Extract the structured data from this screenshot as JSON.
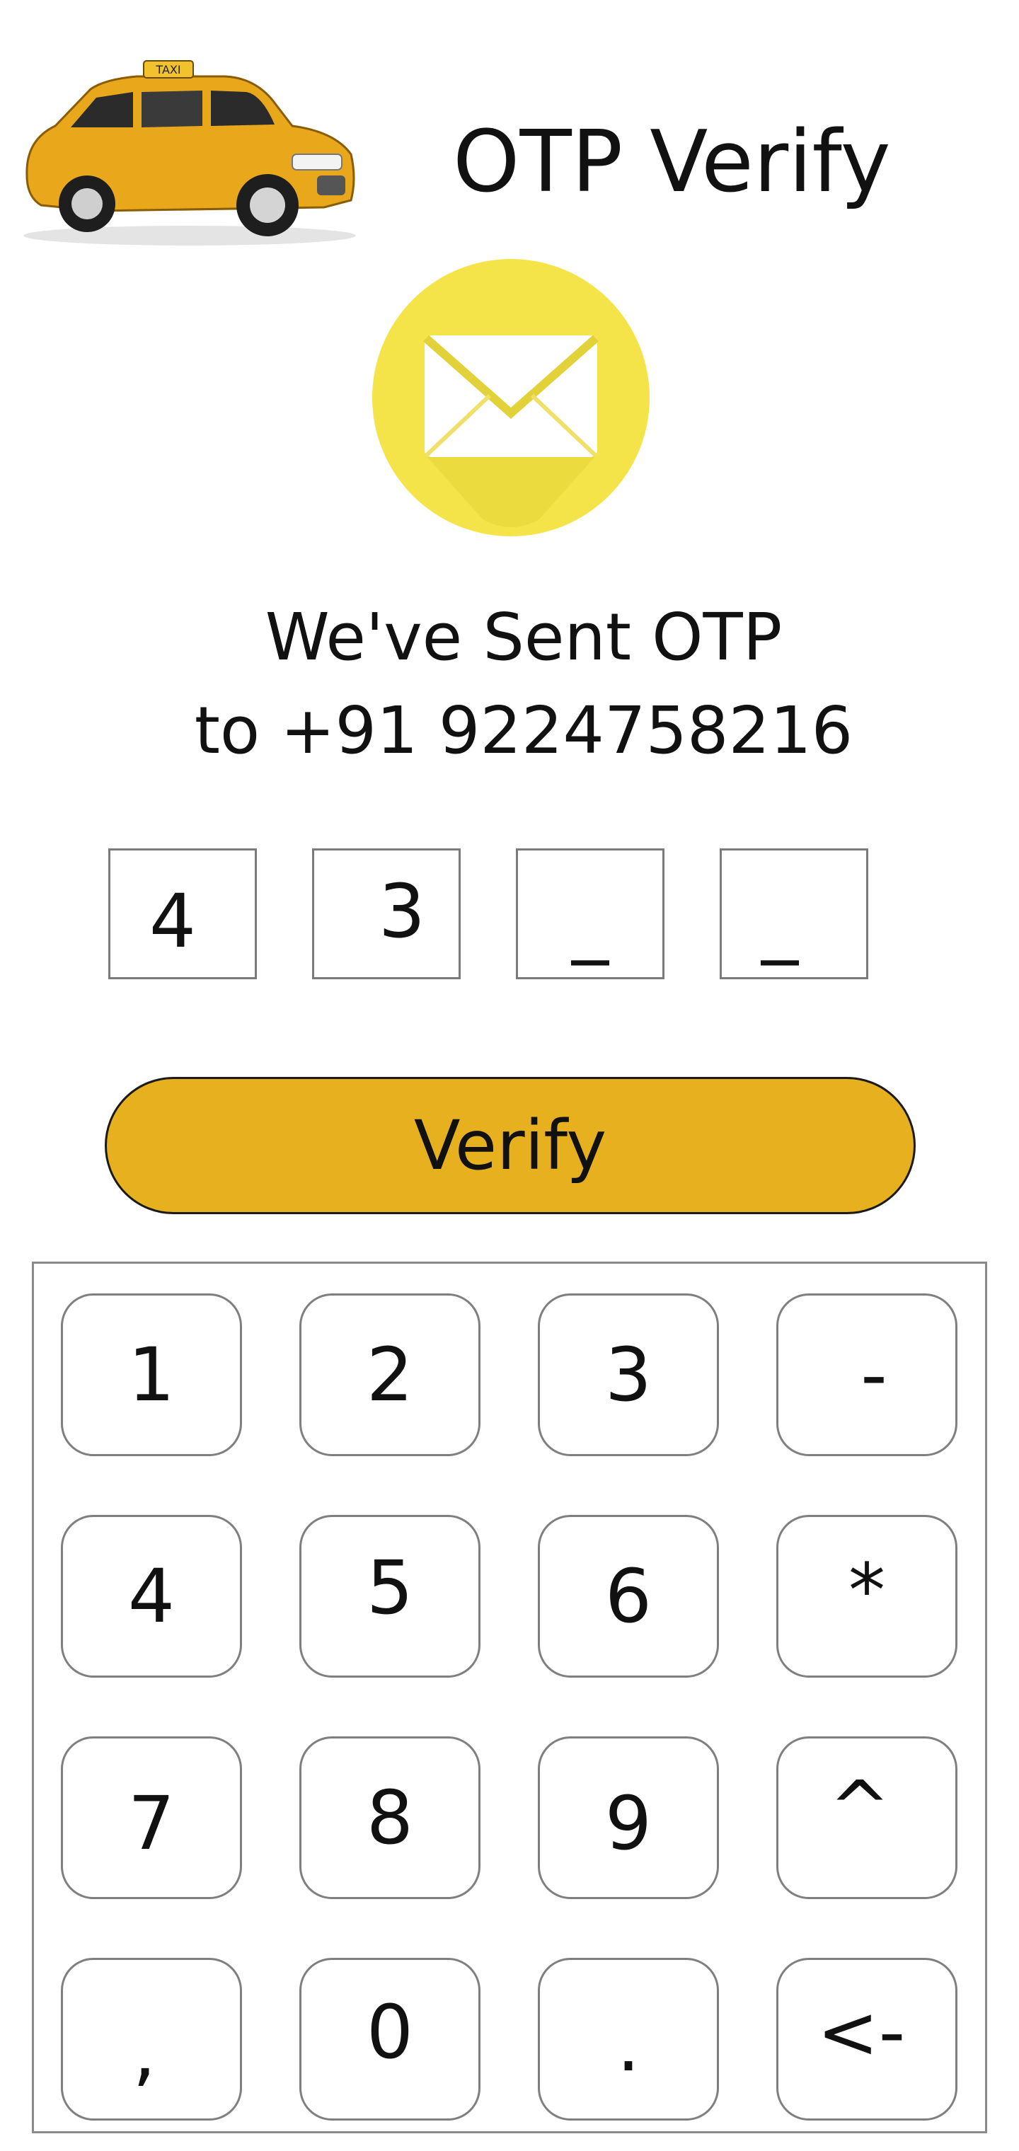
{
  "header": {
    "title": "OTP Verify",
    "taxi_sign": "TAXI"
  },
  "icons": {
    "taxi": "taxi-car-icon",
    "mail": "mail-envelope-icon"
  },
  "message": {
    "line1": "We've Sent OTP",
    "line2": "to +91 9224758216"
  },
  "otp": {
    "digits": [
      "4",
      "3",
      "_",
      "_"
    ]
  },
  "verify": {
    "label": "Verify"
  },
  "keypad": {
    "keys": [
      "1",
      "2",
      "3",
      "-",
      "4",
      "5",
      "6",
      "*",
      "7",
      "8",
      "9",
      "^",
      ",",
      "0",
      ".",
      "<-"
    ]
  },
  "colors": {
    "accent": "#E6B01E",
    "mail_circle": "#F4E44A",
    "taxi_body": "#E9A81C"
  }
}
